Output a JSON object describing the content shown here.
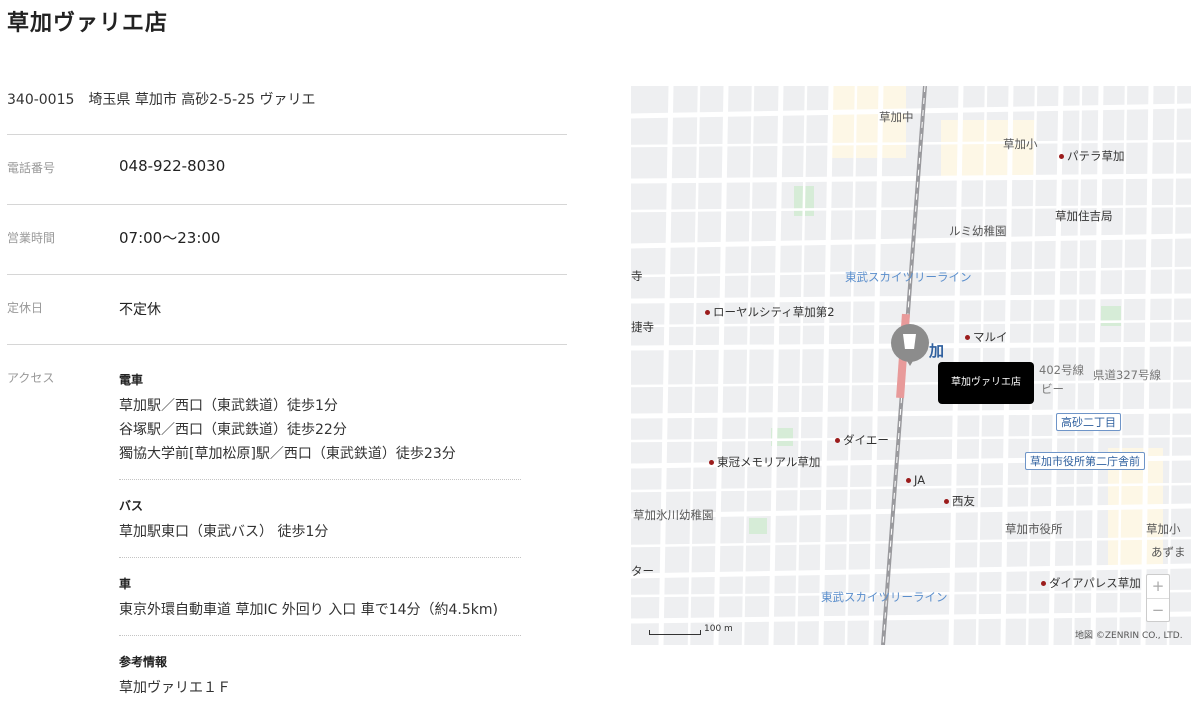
{
  "store": {
    "title": "草加ヴァリエ店",
    "address": "340-0015　埼玉県 草加市 高砂2-5-25 ヴァリエ"
  },
  "info": {
    "phone_label": "電話番号",
    "phone": "048-922-8030",
    "hours_label": "営業時間",
    "hours": "07:00〜23:00",
    "closed_label": "定休日",
    "closed": "不定休",
    "access_label": "アクセス"
  },
  "access": {
    "train_title": "電車",
    "train_lines": [
      "草加駅／西口（東武鉄道）徒歩1分",
      "谷塚駅／西口（東武鉄道）徒歩22分",
      "獨協大学前[草加松原]駅／西口（東武鉄道）徒歩23分"
    ],
    "bus_title": "バス",
    "bus_lines": [
      "草加駅東口（東武バス） 徒歩1分"
    ],
    "car_title": "車",
    "car_lines": [
      "東京外環自動車道 草加IC 外回り 入口 車で14分（約4.5km)"
    ],
    "ref_title": "参考情報",
    "ref_lines": [
      "草加ヴァリエ１Ｆ"
    ]
  },
  "map": {
    "popup": "草加ヴァリエ店",
    "pois": [
      "パテラ草加",
      "草加住吉局",
      "マルイ",
      "ローヤルシティ草加第2",
      "ダイエー",
      "東冠メモリアル草加",
      "JA",
      "西友",
      "ダイアパレス草加"
    ],
    "schools": [
      "草加中",
      "草加小",
      "ルミ幼稚園",
      "草加氷川幼稚園",
      "草加市役所",
      "草加小",
      "あずま"
    ],
    "partial": [
      "寺",
      "捷寺",
      "ター",
      "加",
      "402号線",
      "県道327号線",
      "ビー"
    ],
    "rail_labels": [
      "東武スカイツリーライン",
      "東武スカイツリーライン"
    ],
    "bus_stops": [
      "高砂二丁目",
      "草加市役所第二庁舎前"
    ],
    "zoom_in": "+",
    "zoom_out": "−",
    "scale": "100 m",
    "copyright": "地図 ©ZENRIN CO., LTD."
  }
}
